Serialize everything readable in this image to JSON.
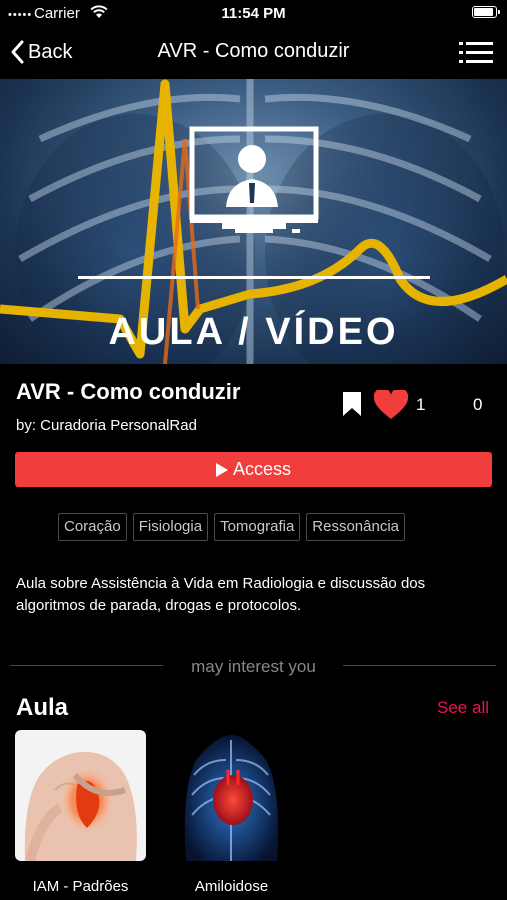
{
  "status_bar": {
    "carrier": "Carrier",
    "time": "11:54 PM"
  },
  "nav": {
    "back_label": "Back",
    "title": "AVR - Como conduzir"
  },
  "hero": {
    "label": "AULA / VÍDEO"
  },
  "lesson": {
    "title": "AVR - Como conduzir",
    "author": "by: Curadoria PersonalRad",
    "likes": "1",
    "comments": "0",
    "access_label": "Access",
    "tags": [
      "Coração",
      "Fisiologia",
      "Tomografia",
      "Ressonância"
    ],
    "description": "Aula sobre Assistência à Vida em Radiologia e discussão dos algoritmos de parada, drogas e protocolos."
  },
  "suggestions": {
    "divider_label": "may interest you",
    "section_title": "Aula",
    "see_all_label": "See all",
    "items": [
      {
        "label": "IAM - Padrões"
      },
      {
        "label": "Amiloidose"
      }
    ]
  },
  "colors": {
    "accent": "#f23d3d",
    "see_all": "#e8154f",
    "background": "#000000"
  }
}
